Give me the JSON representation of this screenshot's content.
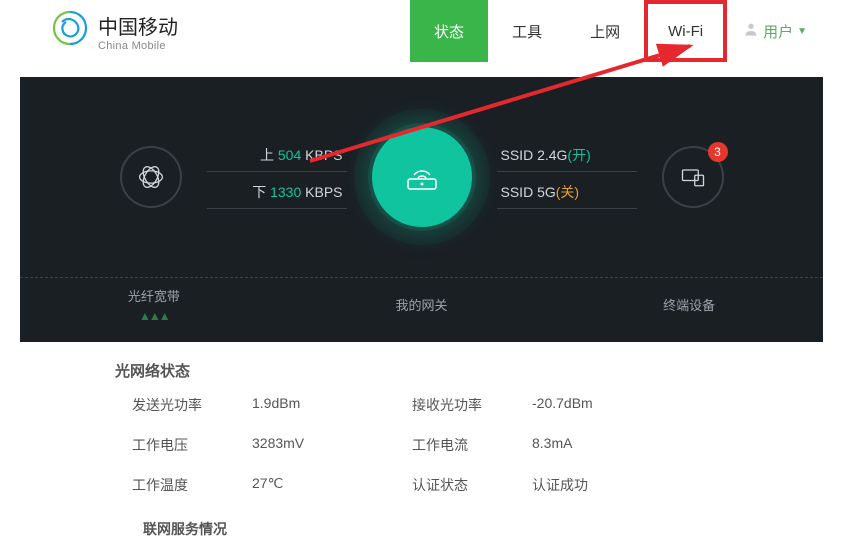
{
  "logo": {
    "cn": "中国移动",
    "en": "China Mobile"
  },
  "nav": {
    "status": "状态",
    "tools": "工具",
    "internet": "上网",
    "wifi": "Wi-Fi"
  },
  "user": {
    "label": "用户"
  },
  "hero": {
    "up_prefix": "上",
    "up_value": "504",
    "kbps": "KBPS",
    "down_prefix": "下",
    "down_value": "1330",
    "ssid24": "SSID 2.4G",
    "ssid24_state": "(开)",
    "ssid5": "SSID 5G",
    "ssid5_state": "(关)",
    "device_badge": "3",
    "footer": {
      "fiber": "光纤宽带",
      "gateway": "我的网关",
      "devices": "终端设备"
    }
  },
  "section": {
    "optical_title": "光网络状态",
    "联网": "联网服务情况"
  },
  "stats": {
    "tx_power_label": "发送光功率",
    "tx_power": "1.9dBm",
    "rx_power_label": "接收光功率",
    "rx_power": "-20.7dBm",
    "voltage_label": "工作电压",
    "voltage": "3283mV",
    "current_label": "工作电流",
    "current": "8.3mA",
    "temp_label": "工作温度",
    "temp": "27℃",
    "auth_label": "认证状态",
    "auth": "认证成功"
  }
}
